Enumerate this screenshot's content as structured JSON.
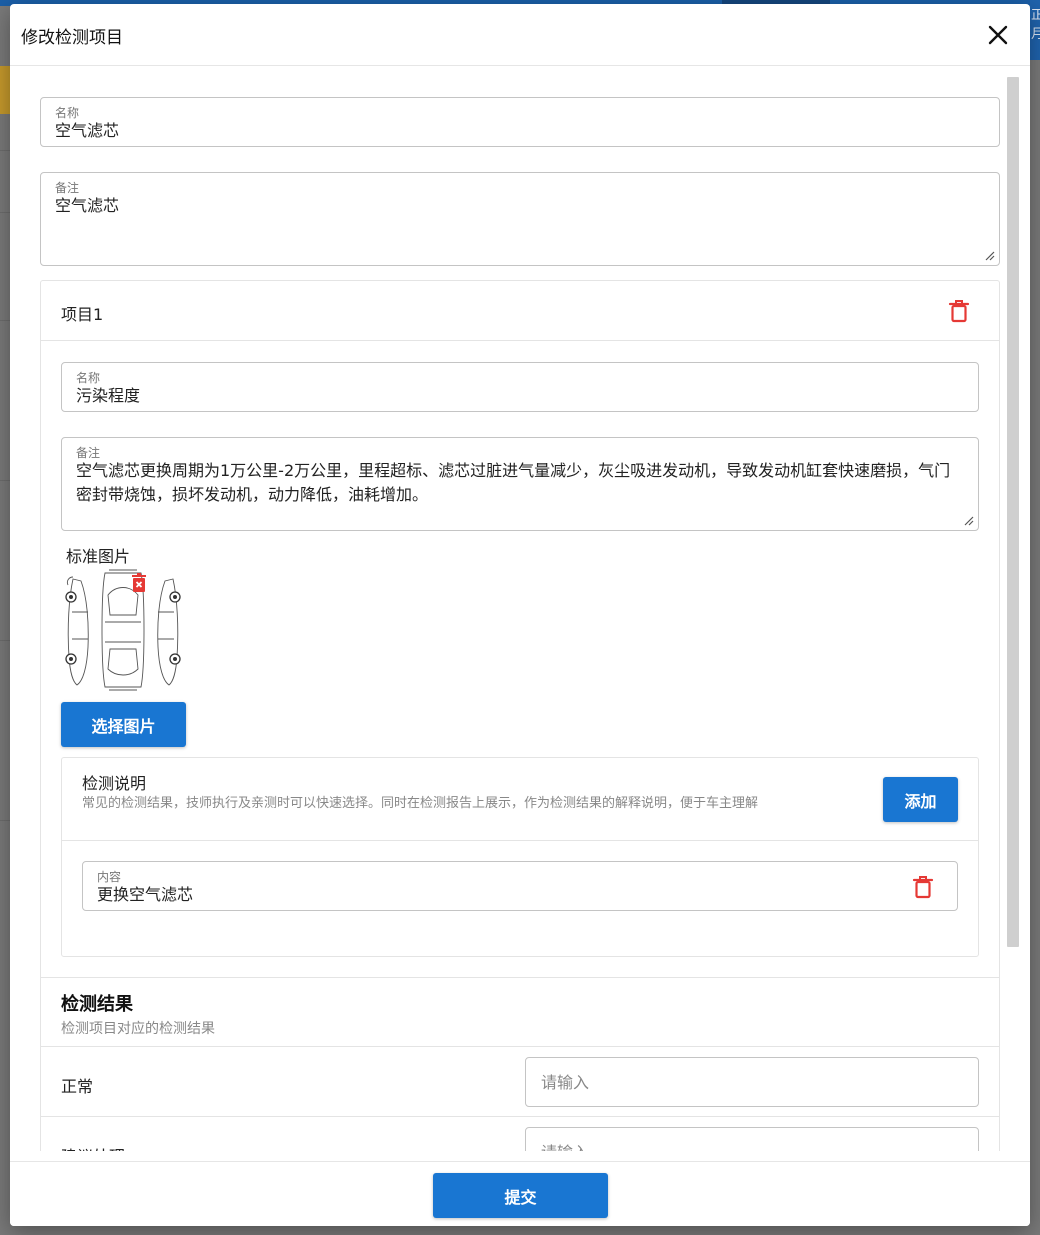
{
  "background": {
    "edge_text": "正月"
  },
  "dialog": {
    "title": "修改检测项目",
    "close_icon": "close-icon"
  },
  "form": {
    "name": {
      "label": "名称",
      "value": "空气滤芯"
    },
    "remark": {
      "label": "备注",
      "value": "空气滤芯"
    }
  },
  "item": {
    "title": "项目1",
    "name": {
      "label": "名称",
      "value": "污染程度"
    },
    "remark": {
      "label": "备注",
      "value": "空气滤芯更换周期为1万公里-2万公里，里程超标、滤芯过脏进气量减少，灰尘吸进发动机，导致发动机缸套快速磨损，气门密封带烧蚀，损坏发动机，动力降低，油耗增加。"
    },
    "standard_image": {
      "title": "标准图片",
      "select_button": "选择图片"
    },
    "detection_desc": {
      "title": "检测说明",
      "subtitle": "常见的检测结果，技师执行及亲测时可以快速选择。同时在检测报告上展示，作为检测结果的解释说明，便于车主理解",
      "add_button": "添加",
      "entries": [
        {
          "label": "内容",
          "value": "更换空气滤芯"
        }
      ]
    },
    "results": {
      "title": "检测结果",
      "subtitle": "检测项目对应的检测结果",
      "rows": [
        {
          "label": "正常",
          "placeholder": "请输入"
        },
        {
          "label": "建议处理",
          "placeholder": "请输入"
        }
      ]
    }
  },
  "footer": {
    "submit_button": "提交"
  },
  "colors": {
    "primary": "#1976d2",
    "danger": "#e53935"
  }
}
